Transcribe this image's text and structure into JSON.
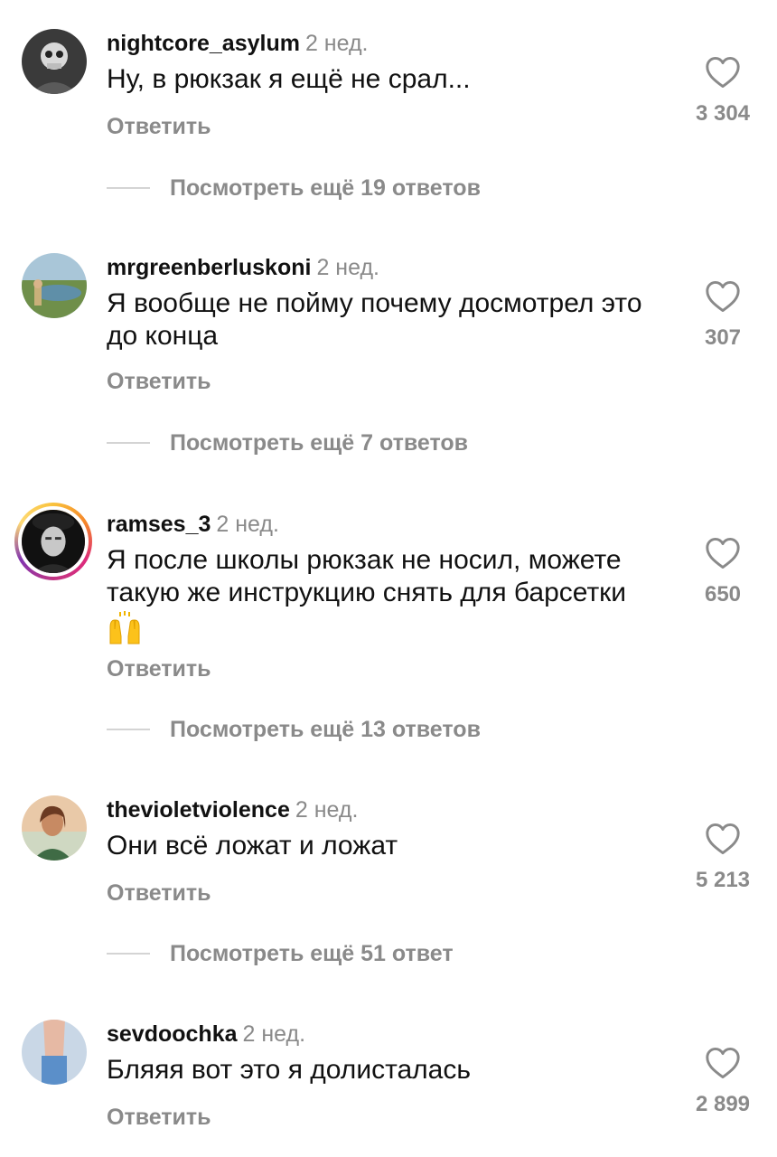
{
  "reply_label": "Ответить",
  "comments": [
    {
      "username": "nightcore_asylum",
      "time": "2 нед.",
      "text": "Ну, в рюкзак я ещё не срал...",
      "likes": "3 304",
      "more_replies": "Посмотреть ещё 19 ответов"
    },
    {
      "username": "mrgreenberluskoni",
      "time": "2 нед.",
      "text": "Я вообще не пойму почему досмотрел это до конца",
      "likes": "307",
      "more_replies": "Посмотреть ещё 7 ответов"
    },
    {
      "username": "ramses_3",
      "time": "2 нед.",
      "text": "Я после школы рюкзак не носил, можете такую же инструкцию снять для барсетки",
      "emoji": "raising-hands",
      "likes": "650",
      "more_replies": "Посмотреть ещё 13 ответов"
    },
    {
      "username": "thevioletviolence",
      "time": "2 нед.",
      "text": "Они всё ложат и ложат",
      "likes": "5 213",
      "more_replies": "Посмотреть ещё 51 ответ"
    },
    {
      "username": "sevdoochka",
      "time": "2 нед.",
      "text": "Бляяя вот это я долисталась",
      "likes": "2 899"
    }
  ],
  "icons": {
    "like": "heart-outline-icon"
  }
}
